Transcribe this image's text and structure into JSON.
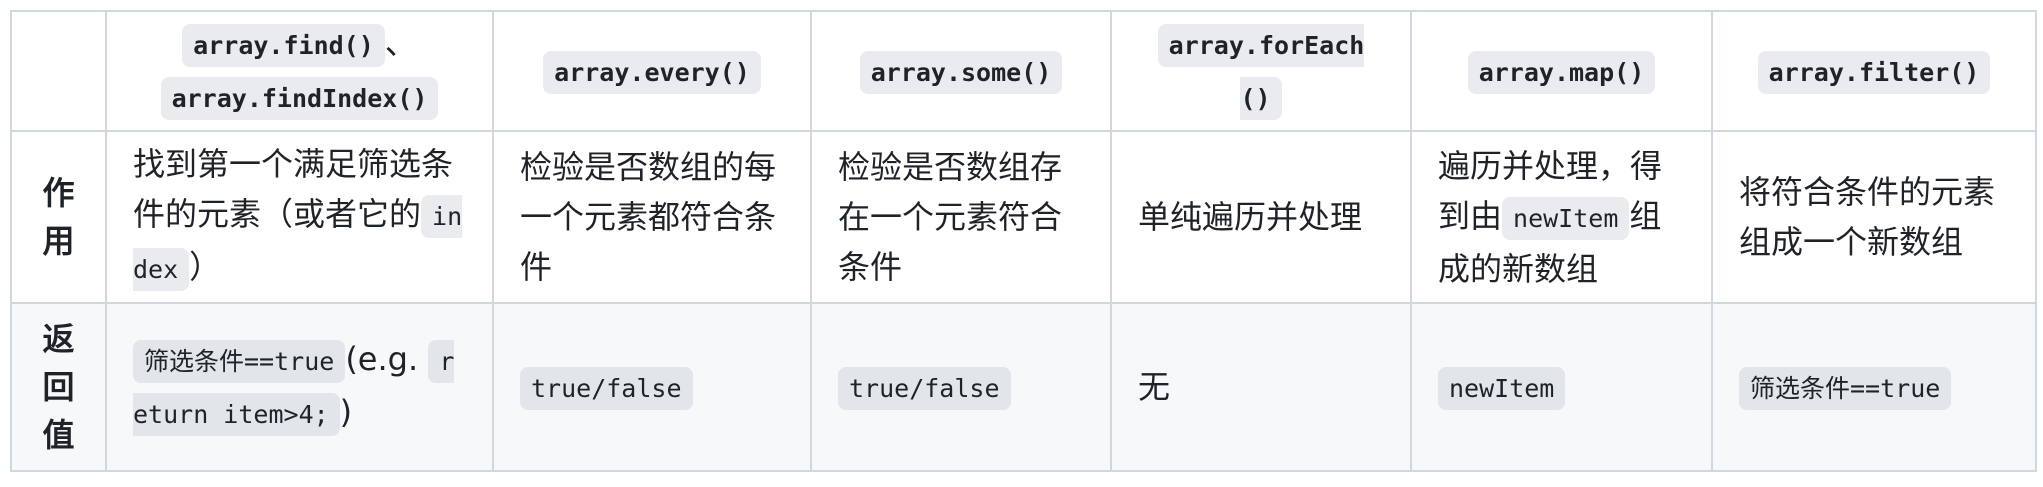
{
  "header": {
    "corner": "",
    "col_find_code_1": "array.find()",
    "col_find_sep": "、",
    "col_find_code_2": "array.findIndex()",
    "col_every": "array.every()",
    "col_some": "array.some()",
    "col_foreach": "array.forEach()",
    "col_map": "array.map()",
    "col_filter": "array.filter()"
  },
  "row_purpose": {
    "label_chars": [
      "作",
      "用"
    ],
    "find_text": "找到第一个满足筛选条件的元素（或者它的",
    "find_code": "index",
    "find_close": "）",
    "every": "检验是否数组的每一个元素都符合条件",
    "some": "检验是否数组存在一个元素符合条件",
    "foreach": "单纯遍历并处理",
    "map_text_1": "遍历并处理，得到由",
    "map_code": "newItem",
    "map_text_2": "组成的新数组",
    "filter": "将符合条件的元素组成一个新数组"
  },
  "row_return": {
    "label_chars": [
      "返",
      "回",
      "值"
    ],
    "find_code_1": "筛选条件==true",
    "find_text": "(e.g. ",
    "find_code_2": "return item>4;",
    "find_close": ")",
    "every_code": "true/false",
    "some_code": "true/false",
    "foreach": "无",
    "map_code": "newItem",
    "filter_code": "筛选条件==true"
  }
}
